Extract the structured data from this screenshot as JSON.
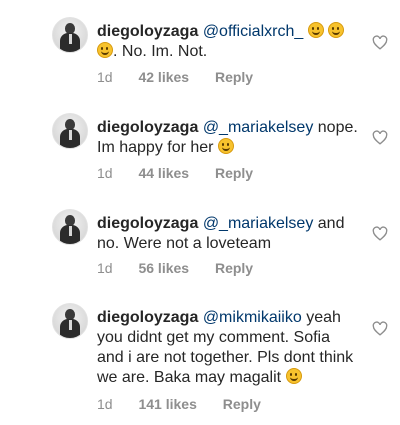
{
  "comments": [
    {
      "username": "diegoloyzaga",
      "mention": "@officialxrch_",
      "text_after_emoji": ". No. Im. Not.",
      "emoji_count_after_mention": 2,
      "emoji_count_before_text": 1,
      "age": "1d",
      "likes": "42 likes",
      "reply": "Reply"
    },
    {
      "username": "diegoloyzaga",
      "mention": "@_mariakelsey",
      "text": "nope. Im happy for her",
      "age": "1d",
      "likes": "44 likes",
      "reply": "Reply"
    },
    {
      "username": "diegoloyzaga",
      "mention": "@_mariakelsey",
      "text": "and no. Were not a loveteam",
      "age": "1d",
      "likes": "56 likes",
      "reply": "Reply"
    },
    {
      "username": "diegoloyzaga",
      "mention": "@mikmikaiiko",
      "text": "yeah you didnt get my comment. Sofia and i are not together. Pls dont think we are. Baka may magalit",
      "age": "1d",
      "likes": "141 likes",
      "reply": "Reply"
    }
  ],
  "icons": {
    "like": "heart-outline-icon",
    "emoji": "grinning-face-emoji"
  },
  "colors": {
    "text": "#262626",
    "mention": "#00376b",
    "meta": "#8e8e8e"
  }
}
